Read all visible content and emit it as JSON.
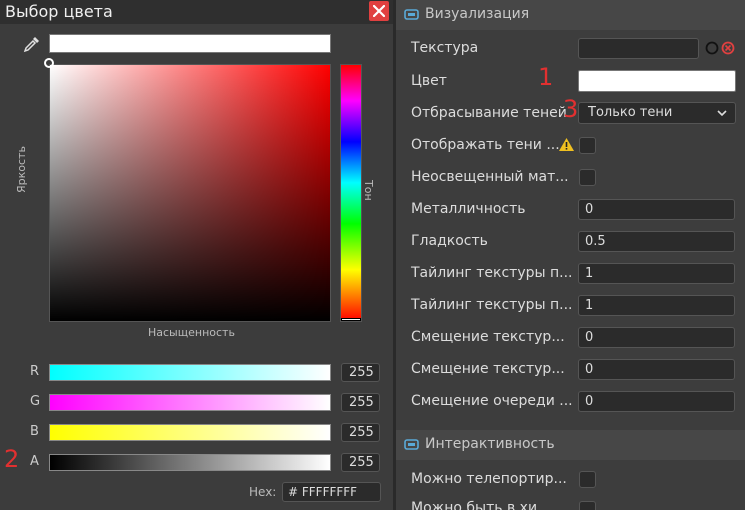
{
  "picker": {
    "title": "Выбор цвета",
    "brightness_label": "Яркость",
    "saturation_label": "Насыщенность",
    "hue_label": "Тон",
    "channels": [
      {
        "label": "R",
        "value": "255"
      },
      {
        "label": "G",
        "value": "255"
      },
      {
        "label": "B",
        "value": "255"
      },
      {
        "label": "A",
        "value": "255"
      }
    ],
    "hex_label": "Hex:",
    "hex_value": "# FFFFFFFF"
  },
  "annotations": {
    "a1": "1",
    "a2": "2",
    "a3": "3"
  },
  "inspector": {
    "visualization": {
      "title": "Визуализация",
      "texture_label": "Текстура",
      "color_label": "Цвет",
      "shadow_cast_label": "Отбрасывание теней",
      "shadow_cast_value": "Только тени",
      "show_shadows_label": "Отображать тени ...",
      "unlit_label": "Неосвещенный мат...",
      "metallic_label": "Металличность",
      "metallic_value": "0",
      "smoothness_label": "Гладкость",
      "smoothness_value": "0.5",
      "tiling_x_label": "Тайлинг текстуры п...",
      "tiling_x_value": "1",
      "tiling_y_label": "Тайлинг текстуры п...",
      "tiling_y_value": "1",
      "offset_x_label": "Смещение текстур...",
      "offset_x_value": "0",
      "offset_y_label": "Смещение текстур...",
      "offset_y_value": "0",
      "queue_offset_label": "Смещение очереди ...",
      "queue_offset_value": "0"
    },
    "interactivity": {
      "title": "Интерактивность",
      "teleport_label": "Можно телепортир...",
      "next_label": "Можно быть в хи..."
    }
  },
  "colors": {
    "accent_red": "#e04040",
    "warning": "#f0c020",
    "section_icon": "#5aaad8"
  }
}
